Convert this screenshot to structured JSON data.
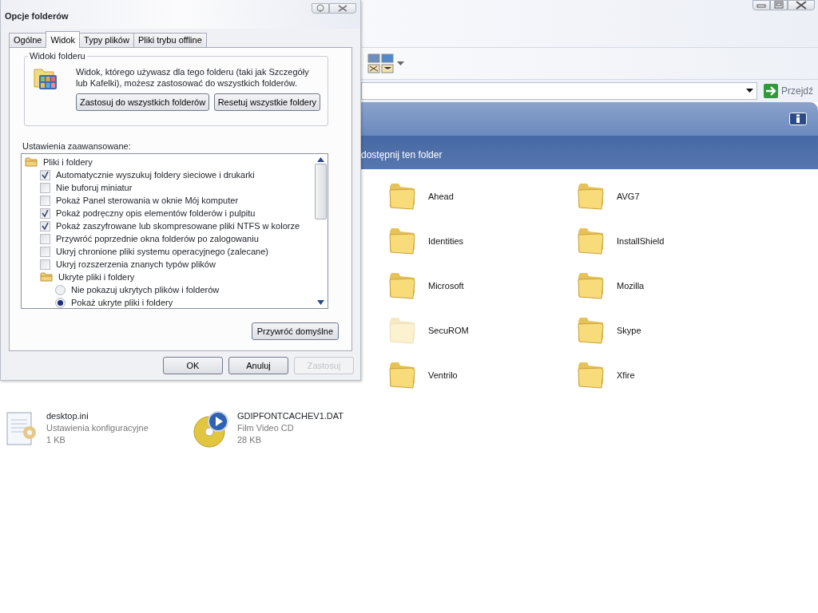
{
  "explorer": {
    "go_button": "Przejdź",
    "task_band_text": "dostępnij ten folder",
    "folders": [
      {
        "name": "Ahead",
        "hidden": false
      },
      {
        "name": "AVG7",
        "hidden": false
      },
      {
        "name": "Identities",
        "hidden": false
      },
      {
        "name": "InstallShield",
        "hidden": false
      },
      {
        "name": "Microsoft",
        "hidden": false
      },
      {
        "name": "Mozilla",
        "hidden": false
      },
      {
        "name": "SecuROM",
        "hidden": true
      },
      {
        "name": "Skype",
        "hidden": false
      },
      {
        "name": "Ventrilo",
        "hidden": false
      },
      {
        "name": "Xfire",
        "hidden": false
      }
    ],
    "files": [
      {
        "kind": "settings",
        "name": "desktop.ini",
        "type": "Ustawienia konfiguracyjne",
        "size": "1 KB"
      },
      {
        "kind": "disc",
        "name": "GDIPFONTCACHEV1.DAT",
        "type": "Film Video CD",
        "size": "28 KB"
      }
    ]
  },
  "dialog": {
    "title": "Opcje folderów",
    "tabs": [
      {
        "label": "Ogólne",
        "selected": false
      },
      {
        "label": "Widok",
        "selected": true
      },
      {
        "label": "Typy plików",
        "selected": false
      },
      {
        "label": "Pliki trybu offline",
        "selected": false
      }
    ],
    "group": {
      "title": "Widoki folderu",
      "text": "Widok, którego używasz dla tego folderu (taki jak Szczegóły lub Kafelki), możesz zastosować do wszystkich folderów.",
      "buttons": [
        "Zastosuj do wszystkich folderów",
        "Resetuj wszystkie foldery"
      ]
    },
    "advanced": {
      "label": "Ustawienia zaawansowane:",
      "items": [
        {
          "kind": "folder",
          "label": "Pliki i foldery",
          "children": [
            {
              "kind": "checkbox",
              "label": "Automatycznie wyszukuj foldery sieciowe i drukarki",
              "checked": true
            },
            {
              "kind": "checkbox",
              "label": "Nie buforuj miniatur",
              "checked": false
            },
            {
              "kind": "checkbox",
              "label": "Pokaż Panel sterowania w oknie Mój komputer",
              "checked": false
            },
            {
              "kind": "checkbox",
              "label": "Pokaż podręczny opis elementów folderów i pulpitu",
              "checked": true
            },
            {
              "kind": "checkbox",
              "label": "Pokaż zaszyfrowane lub skompresowane pliki NTFS w kolorze",
              "checked": true
            },
            {
              "kind": "checkbox",
              "label": "Przywróć poprzednie okna folderów po zalogowaniu",
              "checked": false
            },
            {
              "kind": "checkbox",
              "label": "Ukryj chronione pliki systemu operacyjnego (zalecane)",
              "checked": false
            },
            {
              "kind": "checkbox",
              "label": "Ukryj rozszerzenia znanych typów plików",
              "checked": false
            },
            {
              "kind": "folder",
              "label": "Ukryte pliki i foldery",
              "children": [
                {
                  "kind": "radio",
                  "label": "Nie pokazuj ukrytych plików i folderów",
                  "selected": false
                },
                {
                  "kind": "radio",
                  "label": "Pokaż ukryte pliki i foldery",
                  "selected": true
                }
              ]
            }
          ]
        }
      ]
    },
    "restore_button": "Przywróć domyślne",
    "buttons": [
      {
        "label": "OK",
        "disabled": false
      },
      {
        "label": "Anuluj",
        "disabled": false
      },
      {
        "label": "Zastosuj",
        "disabled": true
      }
    ]
  }
}
